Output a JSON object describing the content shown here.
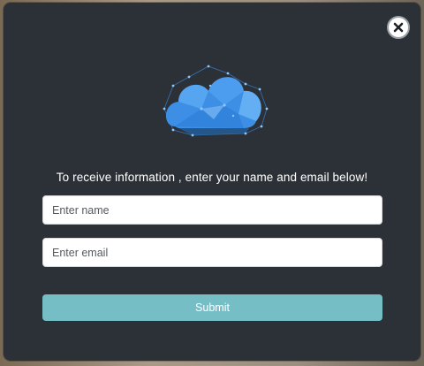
{
  "popup": {
    "headline": "To receive information , enter your name and email below!",
    "close_icon": "close-icon",
    "illustration_icon": "cloud-icon",
    "name_field": {
      "placeholder": "Enter name",
      "value": ""
    },
    "email_field": {
      "placeholder": "Enter email",
      "value": ""
    },
    "submit_label": "Submit"
  },
  "colors": {
    "modal_background": "#2c3138",
    "submit_button": "#76bec5",
    "cloud_primary": "#3d8fe6",
    "cloud_light": "#5aa9f2"
  }
}
